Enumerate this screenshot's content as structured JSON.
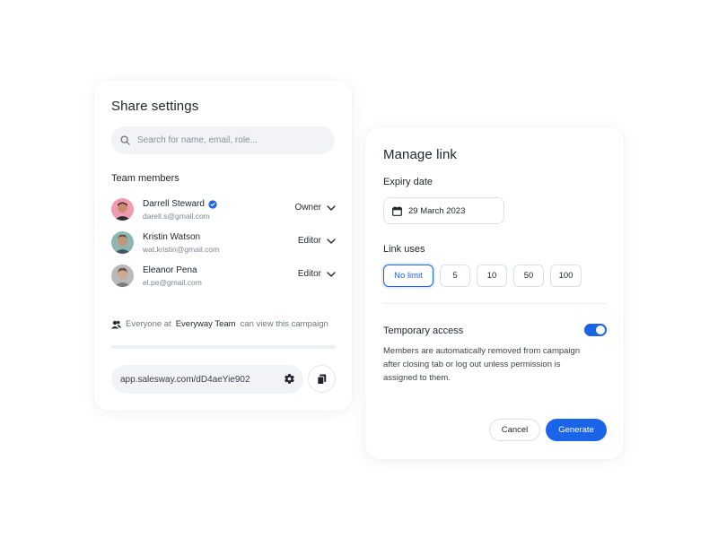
{
  "share": {
    "title": "Share settings",
    "search_placeholder": "Search for name, email, role...",
    "team_label": "Team members",
    "members": [
      {
        "name": "Darrell Steward",
        "email": "darell.s@gmail.com",
        "role": "Owner",
        "verified": true
      },
      {
        "name": "Kristin Watson",
        "email": "wat.kristin@gmail.com",
        "role": "Editor",
        "verified": false
      },
      {
        "name": "Eleanor Pena",
        "email": "el.pe@gmail.com",
        "role": "Editor",
        "verified": false
      }
    ],
    "everyone_prefix": "Everyone at",
    "everyone_team": "Everyway Team",
    "everyone_suffix": "can view this campaign",
    "link_url": "app.salesway.com/dD4aeYie902"
  },
  "manage": {
    "title": "Manage link",
    "expiry_label": "Expiry date",
    "expiry_value": "29 March 2023",
    "uses_label": "Link uses",
    "uses_options": [
      "No limit",
      "5",
      "10",
      "50",
      "100"
    ],
    "uses_selected": "No limit",
    "temp_label": "Temporary access",
    "temp_enabled": true,
    "temp_description": "Members are automatically removed from campaign after closing tab or log out unless permission is assigned to them.",
    "cancel_label": "Cancel",
    "generate_label": "Generate"
  },
  "colors": {
    "accent": "#1b63e8",
    "field_bg": "#f1f3f6",
    "border": "#dde1e6"
  },
  "icons": [
    "search-icon",
    "verified-icon",
    "chevron-down-icon",
    "people-icon",
    "gear-icon",
    "copy-icon",
    "calendar-icon"
  ]
}
